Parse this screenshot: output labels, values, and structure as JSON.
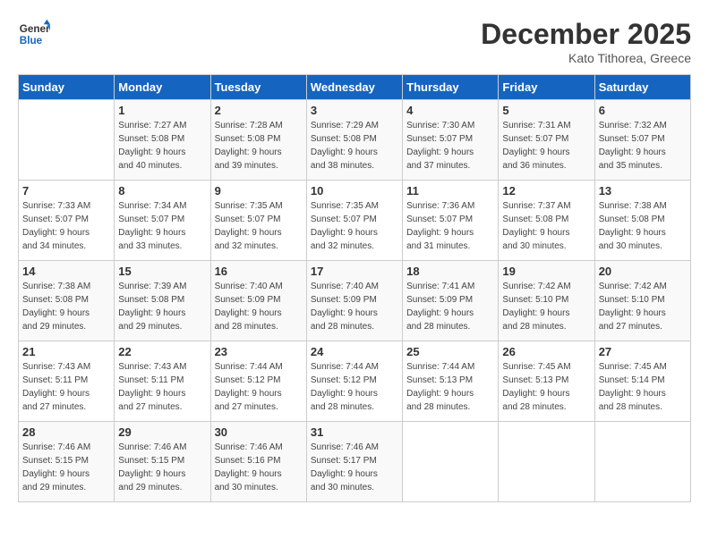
{
  "logo": {
    "line1": "General",
    "line2": "Blue"
  },
  "title": "December 2025",
  "location": "Kato Tithorea, Greece",
  "days_of_week": [
    "Sunday",
    "Monday",
    "Tuesday",
    "Wednesday",
    "Thursday",
    "Friday",
    "Saturday"
  ],
  "weeks": [
    [
      {
        "day": "",
        "info": ""
      },
      {
        "day": "1",
        "info": "Sunrise: 7:27 AM\nSunset: 5:08 PM\nDaylight: 9 hours\nand 40 minutes."
      },
      {
        "day": "2",
        "info": "Sunrise: 7:28 AM\nSunset: 5:08 PM\nDaylight: 9 hours\nand 39 minutes."
      },
      {
        "day": "3",
        "info": "Sunrise: 7:29 AM\nSunset: 5:08 PM\nDaylight: 9 hours\nand 38 minutes."
      },
      {
        "day": "4",
        "info": "Sunrise: 7:30 AM\nSunset: 5:07 PM\nDaylight: 9 hours\nand 37 minutes."
      },
      {
        "day": "5",
        "info": "Sunrise: 7:31 AM\nSunset: 5:07 PM\nDaylight: 9 hours\nand 36 minutes."
      },
      {
        "day": "6",
        "info": "Sunrise: 7:32 AM\nSunset: 5:07 PM\nDaylight: 9 hours\nand 35 minutes."
      }
    ],
    [
      {
        "day": "7",
        "info": "Sunrise: 7:33 AM\nSunset: 5:07 PM\nDaylight: 9 hours\nand 34 minutes."
      },
      {
        "day": "8",
        "info": "Sunrise: 7:34 AM\nSunset: 5:07 PM\nDaylight: 9 hours\nand 33 minutes."
      },
      {
        "day": "9",
        "info": "Sunrise: 7:35 AM\nSunset: 5:07 PM\nDaylight: 9 hours\nand 32 minutes."
      },
      {
        "day": "10",
        "info": "Sunrise: 7:35 AM\nSunset: 5:07 PM\nDaylight: 9 hours\nand 32 minutes."
      },
      {
        "day": "11",
        "info": "Sunrise: 7:36 AM\nSunset: 5:07 PM\nDaylight: 9 hours\nand 31 minutes."
      },
      {
        "day": "12",
        "info": "Sunrise: 7:37 AM\nSunset: 5:08 PM\nDaylight: 9 hours\nand 30 minutes."
      },
      {
        "day": "13",
        "info": "Sunrise: 7:38 AM\nSunset: 5:08 PM\nDaylight: 9 hours\nand 30 minutes."
      }
    ],
    [
      {
        "day": "14",
        "info": "Sunrise: 7:38 AM\nSunset: 5:08 PM\nDaylight: 9 hours\nand 29 minutes."
      },
      {
        "day": "15",
        "info": "Sunrise: 7:39 AM\nSunset: 5:08 PM\nDaylight: 9 hours\nand 29 minutes."
      },
      {
        "day": "16",
        "info": "Sunrise: 7:40 AM\nSunset: 5:09 PM\nDaylight: 9 hours\nand 28 minutes."
      },
      {
        "day": "17",
        "info": "Sunrise: 7:40 AM\nSunset: 5:09 PM\nDaylight: 9 hours\nand 28 minutes."
      },
      {
        "day": "18",
        "info": "Sunrise: 7:41 AM\nSunset: 5:09 PM\nDaylight: 9 hours\nand 28 minutes."
      },
      {
        "day": "19",
        "info": "Sunrise: 7:42 AM\nSunset: 5:10 PM\nDaylight: 9 hours\nand 28 minutes."
      },
      {
        "day": "20",
        "info": "Sunrise: 7:42 AM\nSunset: 5:10 PM\nDaylight: 9 hours\nand 27 minutes."
      }
    ],
    [
      {
        "day": "21",
        "info": "Sunrise: 7:43 AM\nSunset: 5:11 PM\nDaylight: 9 hours\nand 27 minutes."
      },
      {
        "day": "22",
        "info": "Sunrise: 7:43 AM\nSunset: 5:11 PM\nDaylight: 9 hours\nand 27 minutes."
      },
      {
        "day": "23",
        "info": "Sunrise: 7:44 AM\nSunset: 5:12 PM\nDaylight: 9 hours\nand 27 minutes."
      },
      {
        "day": "24",
        "info": "Sunrise: 7:44 AM\nSunset: 5:12 PM\nDaylight: 9 hours\nand 28 minutes."
      },
      {
        "day": "25",
        "info": "Sunrise: 7:44 AM\nSunset: 5:13 PM\nDaylight: 9 hours\nand 28 minutes."
      },
      {
        "day": "26",
        "info": "Sunrise: 7:45 AM\nSunset: 5:13 PM\nDaylight: 9 hours\nand 28 minutes."
      },
      {
        "day": "27",
        "info": "Sunrise: 7:45 AM\nSunset: 5:14 PM\nDaylight: 9 hours\nand 28 minutes."
      }
    ],
    [
      {
        "day": "28",
        "info": "Sunrise: 7:46 AM\nSunset: 5:15 PM\nDaylight: 9 hours\nand 29 minutes."
      },
      {
        "day": "29",
        "info": "Sunrise: 7:46 AM\nSunset: 5:15 PM\nDaylight: 9 hours\nand 29 minutes."
      },
      {
        "day": "30",
        "info": "Sunrise: 7:46 AM\nSunset: 5:16 PM\nDaylight: 9 hours\nand 30 minutes."
      },
      {
        "day": "31",
        "info": "Sunrise: 7:46 AM\nSunset: 5:17 PM\nDaylight: 9 hours\nand 30 minutes."
      },
      {
        "day": "",
        "info": ""
      },
      {
        "day": "",
        "info": ""
      },
      {
        "day": "",
        "info": ""
      }
    ]
  ]
}
